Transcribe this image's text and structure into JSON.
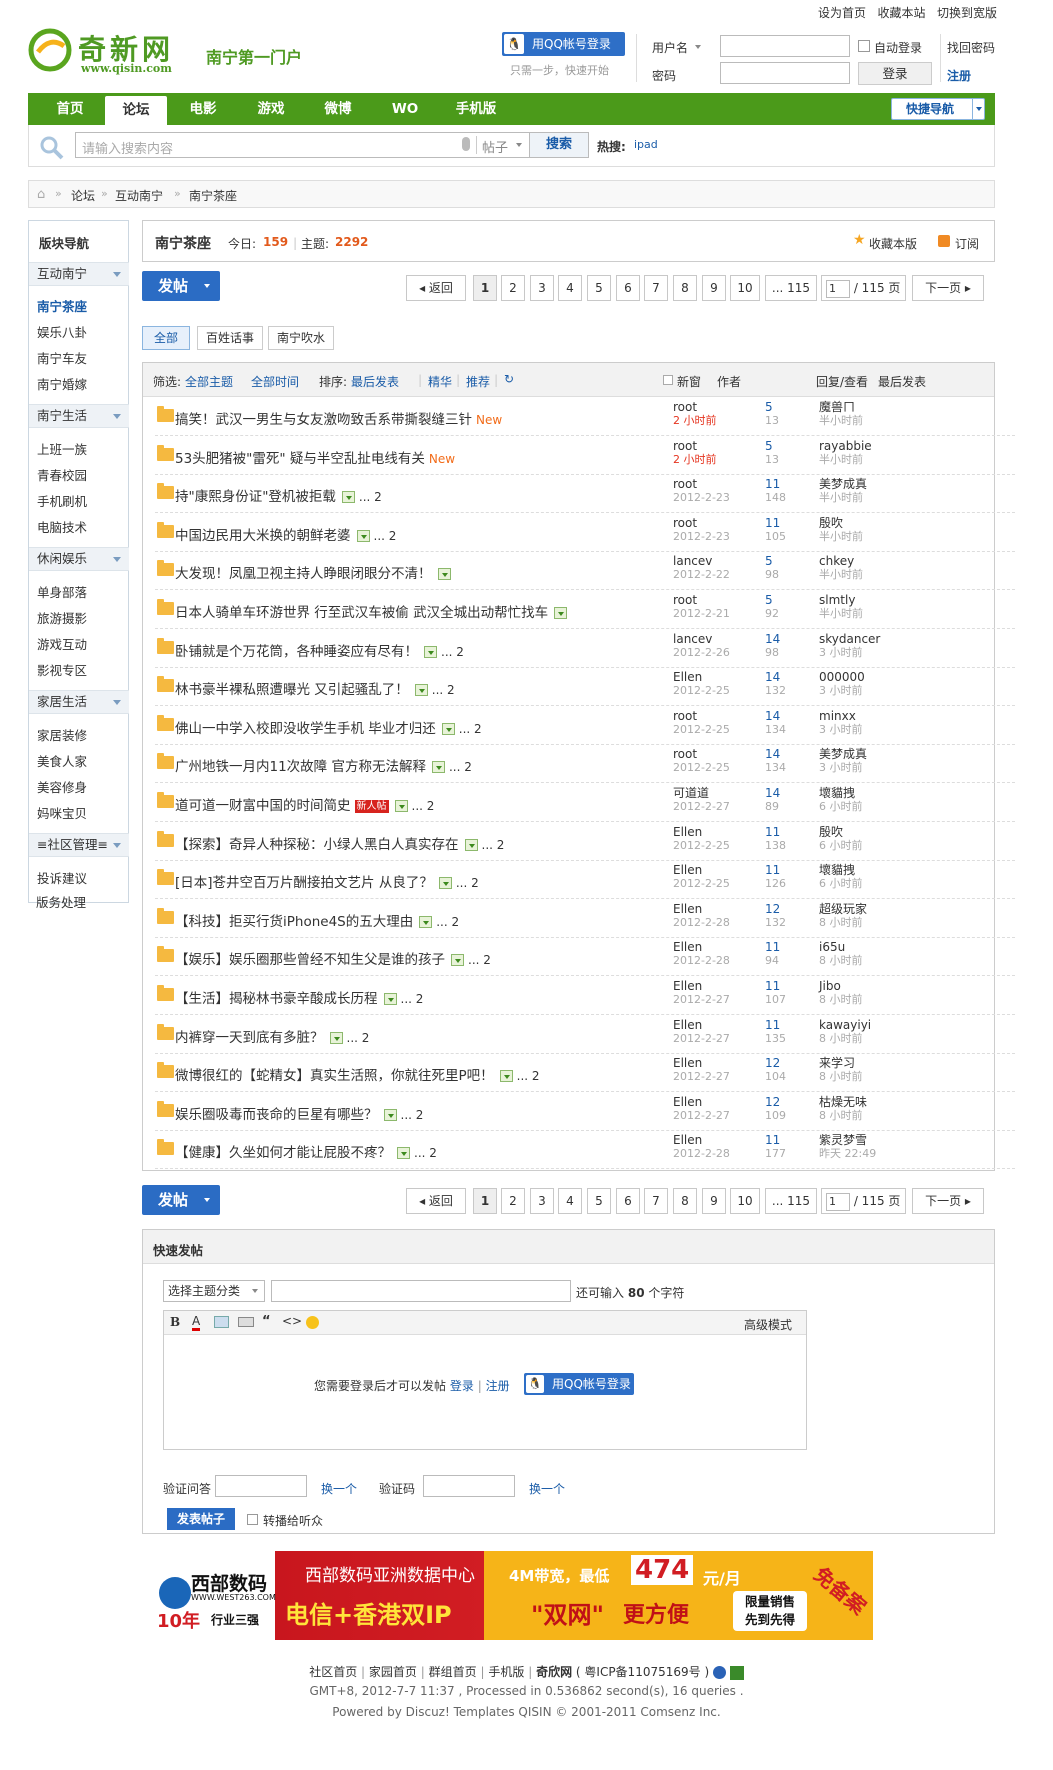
{
  "top_links": [
    "设为首页",
    "收藏本站",
    "切换到宽版"
  ],
  "logo": {
    "name": "奇新网",
    "url": "www.qisin.com",
    "slogan": "南宁第一门户"
  },
  "login": {
    "qq_button": "用QQ帐号登录",
    "qq_hint": "只需一步，快速开始",
    "username_label": "用户名",
    "password_label": "密码",
    "auto_login": "自动登录",
    "login_button": "登录",
    "find_password": "找回密码",
    "register": "注册"
  },
  "nav": {
    "tabs": [
      "首页",
      "论坛",
      "电影",
      "游戏",
      "微博",
      "WO",
      "手机版"
    ],
    "active": "论坛",
    "quick_nav": "快捷导航"
  },
  "search": {
    "placeholder": "请输入搜索内容",
    "type": "帖子",
    "button": "搜索",
    "hot_label": "热搜:",
    "hot_item": "ipad"
  },
  "breadcrumb": [
    "论坛",
    "互动南宁",
    "南宁茶座"
  ],
  "sidebar": {
    "title": "版块导航",
    "groups": [
      {
        "name": "互动南宁",
        "items": [
          "南宁茶座",
          "娱乐八卦",
          "南宁车友",
          "南宁婚嫁"
        ]
      },
      {
        "name": "南宁生活",
        "items": [
          "上班一族",
          "青春校园",
          "手机刷机",
          "电脑技术"
        ]
      },
      {
        "name": "休闲娱乐",
        "items": [
          "单身部落",
          "旅游摄影",
          "游戏互动",
          "影视专区"
        ]
      },
      {
        "name": "家居生活",
        "items": [
          "家居装修",
          "美食人家",
          "美容修身",
          "妈咪宝贝"
        ]
      },
      {
        "name": "≡社区管理≡",
        "items": [
          "投诉建议",
          "版务处理"
        ]
      }
    ]
  },
  "forum": {
    "name": "南宁茶座",
    "today_label": "今日:",
    "today": "159",
    "threads_label": "主题:",
    "threads": "2292",
    "favorite": "收藏本版",
    "subscribe": "订阅"
  },
  "post_button": "发帖",
  "pagination": {
    "back": "返回",
    "pages": [
      "1",
      "2",
      "3",
      "4",
      "5",
      "6",
      "7",
      "8",
      "9",
      "10"
    ],
    "last": "... 115",
    "input_value": "1",
    "total": "/ 115 页",
    "next": "下一页"
  },
  "type_tabs": [
    "全部",
    "百姓话事",
    "南宁吹水"
  ],
  "filter": {
    "label": "筛选:",
    "all_topics": "全部主题",
    "all_time": "全部时间",
    "sort_label": "排序:",
    "sort": "最后发表",
    "digest": "精华",
    "recommend": "推荐",
    "new_window": "新窗",
    "col_author": "作者",
    "col_replies": "回复/查看",
    "col_last": "最后发表"
  },
  "threads": [
    {
      "title": "搞笑！武汉一男生与女友激吻致舌系带撕裂缝三针",
      "tag": "New",
      "img": false,
      "pages": "",
      "author": "root",
      "date": "2 小时前",
      "date_red": true,
      "replies": "5",
      "views": "13",
      "last_user": "魔兽ㄇ",
      "last_time": "半小时前"
    },
    {
      "title": "53头肥猪被\"雷死\" 疑与半空乱扯电线有关",
      "tag": "New",
      "img": false,
      "pages": "",
      "author": "root",
      "date": "2 小时前",
      "date_red": true,
      "replies": "5",
      "views": "13",
      "last_user": "rayabbie",
      "last_time": "半小时前"
    },
    {
      "title": "持\"康熙身份证\"登机被拒载",
      "tag": "",
      "img": true,
      "pages": "... 2",
      "author": "root",
      "date": "2012-2-23",
      "date_red": false,
      "replies": "11",
      "views": "148",
      "last_user": "美梦成真",
      "last_time": "半小时前"
    },
    {
      "title": "中国边民用大米换的朝鲜老婆",
      "tag": "",
      "img": true,
      "pages": "... 2",
      "author": "root",
      "date": "2012-2-23",
      "date_red": false,
      "replies": "11",
      "views": "105",
      "last_user": "殷吹",
      "last_time": "半小时前"
    },
    {
      "title": "大发现！凤凰卫视主持人睁眼闭眼分不清！",
      "tag": "",
      "img": true,
      "pages": "",
      "author": "lancev",
      "date": "2012-2-22",
      "date_red": false,
      "replies": "5",
      "views": "98",
      "last_user": "chkey",
      "last_time": "半小时前"
    },
    {
      "title": "日本人骑单车环游世界 行至武汉车被偷 武汉全城出动帮忙找车",
      "tag": "",
      "img": true,
      "pages": "",
      "author": "root",
      "date": "2012-2-21",
      "date_red": false,
      "replies": "5",
      "views": "92",
      "last_user": "slmtly",
      "last_time": "半小时前"
    },
    {
      "title": "卧铺就是个万花筒，各种睡姿应有尽有！",
      "tag": "",
      "img": true,
      "pages": "... 2",
      "author": "lancev",
      "date": "2012-2-26",
      "date_red": false,
      "replies": "14",
      "views": "98",
      "last_user": "skydancer",
      "last_time": "3 小时前"
    },
    {
      "title": "林书豪半裸私照遭曝光 又引起骚乱了！",
      "tag": "",
      "img": true,
      "pages": "... 2",
      "author": "Ellen",
      "date": "2012-2-25",
      "date_red": false,
      "replies": "14",
      "views": "132",
      "last_user": "000000",
      "last_time": "3 小时前"
    },
    {
      "title": "佛山一中学入校即没收学生手机 毕业才归还",
      "tag": "",
      "img": true,
      "pages": "... 2",
      "author": "root",
      "date": "2012-2-25",
      "date_red": false,
      "replies": "14",
      "views": "134",
      "last_user": "minxx",
      "last_time": "3 小时前"
    },
    {
      "title": "广州地铁一月内11次故障 官方称无法解释",
      "tag": "",
      "img": true,
      "pages": "... 2",
      "author": "root",
      "date": "2012-2-25",
      "date_red": false,
      "replies": "14",
      "views": "134",
      "last_user": "美梦成真",
      "last_time": "3 小时前"
    },
    {
      "title": "道可道一财富中国的时间简史",
      "tag": "新人帖",
      "img": true,
      "pages": "... 2",
      "author": "可道道",
      "date": "2012-2-27",
      "date_red": false,
      "replies": "14",
      "views": "89",
      "last_user": "壞貓拽",
      "last_time": "6 小时前"
    },
    {
      "title": "【探索】奇异人种探秘：小绿人黑白人真实存在",
      "tag": "",
      "img": true,
      "pages": "... 2",
      "author": "Ellen",
      "date": "2012-2-25",
      "date_red": false,
      "replies": "11",
      "views": "138",
      "last_user": "殷吹",
      "last_time": "6 小时前"
    },
    {
      "title": "[日本]苍井空百万片酬接拍文艺片 从良了？",
      "tag": "",
      "img": true,
      "pages": "... 2",
      "author": "Ellen",
      "date": "2012-2-25",
      "date_red": false,
      "replies": "11",
      "views": "126",
      "last_user": "壞貓拽",
      "last_time": "6 小时前"
    },
    {
      "title": "【科技】拒买行货iPhone4S的五大理由",
      "tag": "",
      "img": true,
      "pages": "... 2",
      "author": "Ellen",
      "date": "2012-2-28",
      "date_red": false,
      "replies": "12",
      "views": "132",
      "last_user": "超级玩家",
      "last_time": "8 小时前"
    },
    {
      "title": "【娱乐】娱乐圈那些曾经不知生父是谁的孩子",
      "tag": "",
      "img": true,
      "pages": "... 2",
      "author": "Ellen",
      "date": "2012-2-28",
      "date_red": false,
      "replies": "11",
      "views": "94",
      "last_user": "i65u",
      "last_time": "8 小时前"
    },
    {
      "title": "【生活】揭秘林书豪辛酸成长历程",
      "tag": "",
      "img": true,
      "pages": "... 2",
      "author": "Ellen",
      "date": "2012-2-27",
      "date_red": false,
      "replies": "11",
      "views": "107",
      "last_user": "Jibo",
      "last_time": "8 小时前"
    },
    {
      "title": "内裤穿一天到底有多脏？",
      "tag": "",
      "img": true,
      "pages": "... 2",
      "author": "Ellen",
      "date": "2012-2-27",
      "date_red": false,
      "replies": "11",
      "views": "135",
      "last_user": "kawayiyi",
      "last_time": "8 小时前"
    },
    {
      "title": "微博很红的【蛇精女】真实生活照，你就往死里P吧！",
      "tag": "",
      "img": true,
      "pages": "... 2",
      "author": "Ellen",
      "date": "2012-2-27",
      "date_red": false,
      "replies": "12",
      "views": "104",
      "last_user": "来学习",
      "last_time": "8 小时前"
    },
    {
      "title": "娱乐圈吸毒而丧命的巨星有哪些？",
      "tag": "",
      "img": true,
      "pages": "... 2",
      "author": "Ellen",
      "date": "2012-2-27",
      "date_red": false,
      "replies": "12",
      "views": "109",
      "last_user": "枯燥无味",
      "last_time": "8 小时前"
    },
    {
      "title": "【健康】久坐如何才能让屁股不疼？",
      "tag": "",
      "img": true,
      "pages": "... 2",
      "author": "Ellen",
      "date": "2012-2-28",
      "date_red": false,
      "replies": "11",
      "views": "177",
      "last_user": "紫灵梦雪",
      "last_time": "昨天 22:49"
    }
  ],
  "quick_post": {
    "title": "快速发帖",
    "category": "选择主题分类",
    "char_hint_pre": "还可输入",
    "char_count": "80",
    "char_hint_post": "个字符",
    "advanced": "高级模式",
    "login_notice": "您需要登录后才可以发帖",
    "login": "登录",
    "register": "注册",
    "qq_login": "用QQ帐号登录",
    "verify_q": "验证问答",
    "change1": "换一个",
    "captcha": "验证码",
    "change2": "换一个",
    "submit": "发表帖子",
    "broadcast": "转播给听众"
  },
  "ad": {
    "brand": "西部数码",
    "brand_url": "WWW.WEST263.COM",
    "years": "10年",
    "rank": "行业三强",
    "line1": "西部数码亚洲数据中心",
    "line2": "电信+香港双IP",
    "band": "4M带宽，最低",
    "price": "474",
    "unit": "元/月",
    "dual": "\"双网\"",
    "easy": "更方便",
    "limited": "限量销售",
    "first": "先到先得",
    "corner": "免备案"
  },
  "footer": {
    "links": [
      "社区首页",
      "家园首页",
      "群组首页",
      "手机版"
    ],
    "site": "奇欣网",
    "icp": "( 粤ICP备11075169号 )",
    "line2": "GMT+8, 2012-7-7 11:37 , Processed in 0.536862 second(s), 16 queries .",
    "line3": "Powered by Discuz! Templates QISIN © 2001-2011 Comsenz Inc."
  },
  "colors": {
    "nav_green": "#4b9a1a",
    "post_blue": "#2b6cc4",
    "link_blue": "#1a5ca8",
    "count_orange": "#e25a1c"
  }
}
